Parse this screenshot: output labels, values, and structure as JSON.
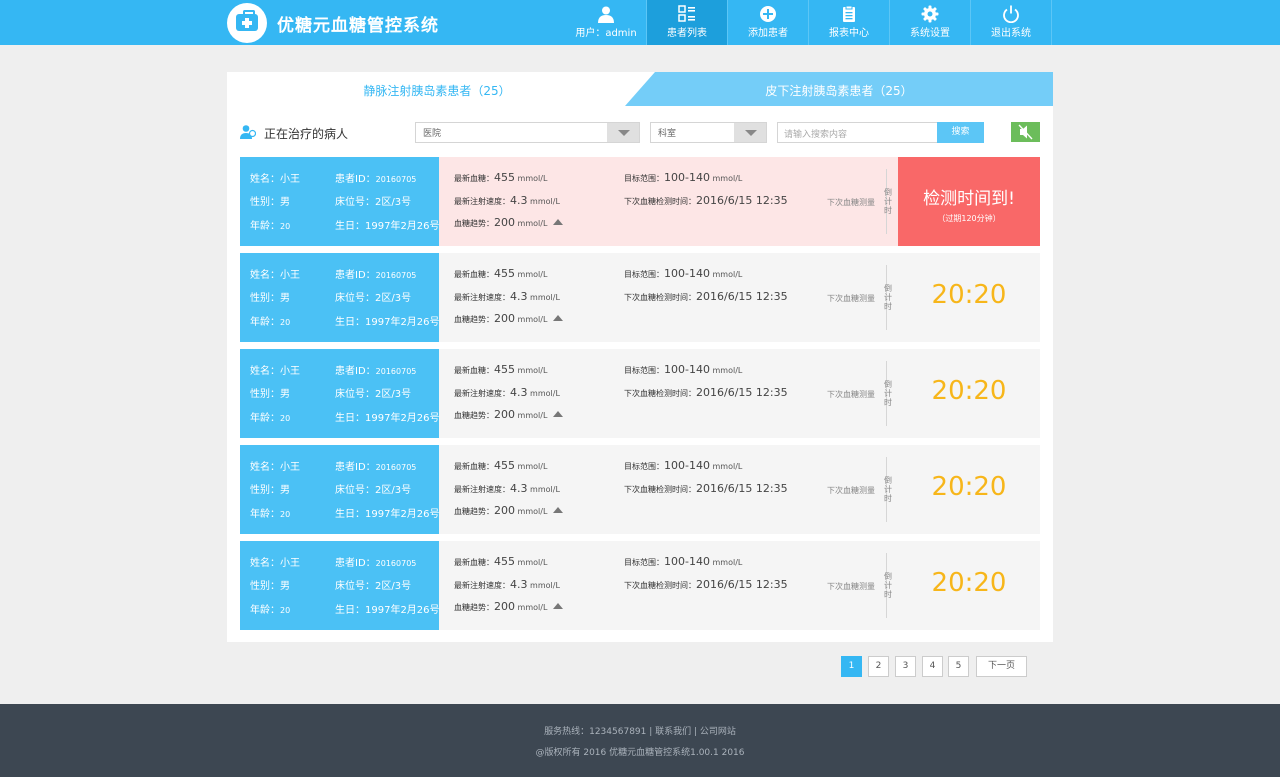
{
  "app": {
    "title": "优糖元血糖管控系统"
  },
  "nav": {
    "user_label": "用户：admin",
    "items": [
      {
        "label": "患者列表",
        "icon": "list-icon"
      },
      {
        "label": "添加患者",
        "icon": "add-icon"
      },
      {
        "label": "报表中心",
        "icon": "report-icon"
      },
      {
        "label": "系统设置",
        "icon": "gear-icon"
      },
      {
        "label": "退出系统",
        "icon": "power-icon"
      }
    ],
    "active": "患者列表"
  },
  "tabs": [
    {
      "label": "静脉注射胰岛素患者（25）",
      "active": true
    },
    {
      "label": "皮下注射胰岛素患者（25）",
      "active": false
    }
  ],
  "filter": {
    "title": "正在治疗的病人",
    "hospital": "医院",
    "department": "科室",
    "search_placeholder": "请输入搜索内容",
    "search_button": "搜索"
  },
  "labels": {
    "name": "姓名：",
    "patient_id": "患者ID：",
    "gender": "性别：",
    "bed": "床位号：",
    "age": "年龄：",
    "birthday": "生日：",
    "latest_glucose": "最新血糖：",
    "target_range": "目标范围：",
    "injection_speed": "最新注射速度：",
    "next_check": "下次血糖检测时间：",
    "trend": "血糖趋势：",
    "next_measure": "下次血糖测量",
    "countdown": "倒计时",
    "unit": "mmol/L"
  },
  "patients": [
    {
      "name": "小王",
      "id": "20160705",
      "gender": "男",
      "bed": "2区/3号",
      "age": "20",
      "birthday": "1997年2月26号",
      "glucose": "455",
      "target": "100-140",
      "speed": "4.3",
      "next_time": "2016/6/15 12:35",
      "trend": "200",
      "timer": "",
      "alarm": true
    },
    {
      "name": "小王",
      "id": "20160705",
      "gender": "男",
      "bed": "2区/3号",
      "age": "20",
      "birthday": "1997年2月26号",
      "glucose": "455",
      "target": "100-140",
      "speed": "4.3",
      "next_time": "2016/6/15 12:35",
      "trend": "200",
      "timer": "20:20",
      "alarm": false
    },
    {
      "name": "小王",
      "id": "20160705",
      "gender": "男",
      "bed": "2区/3号",
      "age": "20",
      "birthday": "1997年2月26号",
      "glucose": "455",
      "target": "100-140",
      "speed": "4.3",
      "next_time": "2016/6/15 12:35",
      "trend": "200",
      "timer": "20:20",
      "alarm": false
    },
    {
      "name": "小王",
      "id": "20160705",
      "gender": "男",
      "bed": "2区/3号",
      "age": "20",
      "birthday": "1997年2月26号",
      "glucose": "455",
      "target": "100-140",
      "speed": "4.3",
      "next_time": "2016/6/15 12:35",
      "trend": "200",
      "timer": "20:20",
      "alarm": false
    },
    {
      "name": "小王",
      "id": "20160705",
      "gender": "男",
      "bed": "2区/3号",
      "age": "20",
      "birthday": "1997年2月26号",
      "glucose": "455",
      "target": "100-140",
      "speed": "4.3",
      "next_time": "2016/6/15 12:35",
      "trend": "200",
      "timer": "20:20",
      "alarm": false
    }
  ],
  "alarm": {
    "message": "检测时间到!",
    "sub": "（过期120分钟）"
  },
  "pagination": {
    "pages": [
      "1",
      "2",
      "3",
      "4",
      "5"
    ],
    "current": "1",
    "next_label": "下一页"
  },
  "footer": {
    "line1": "服务热线：1234567891 | 联系我们 | 公司网站",
    "line2": "@版权所有 2016  优糖元血糖管控系统1.00.1 2016"
  },
  "colors": {
    "brand": "#35b7f3",
    "alarm": "#f96868",
    "timer": "#f7b61a",
    "mute": "#6cbd5b"
  }
}
